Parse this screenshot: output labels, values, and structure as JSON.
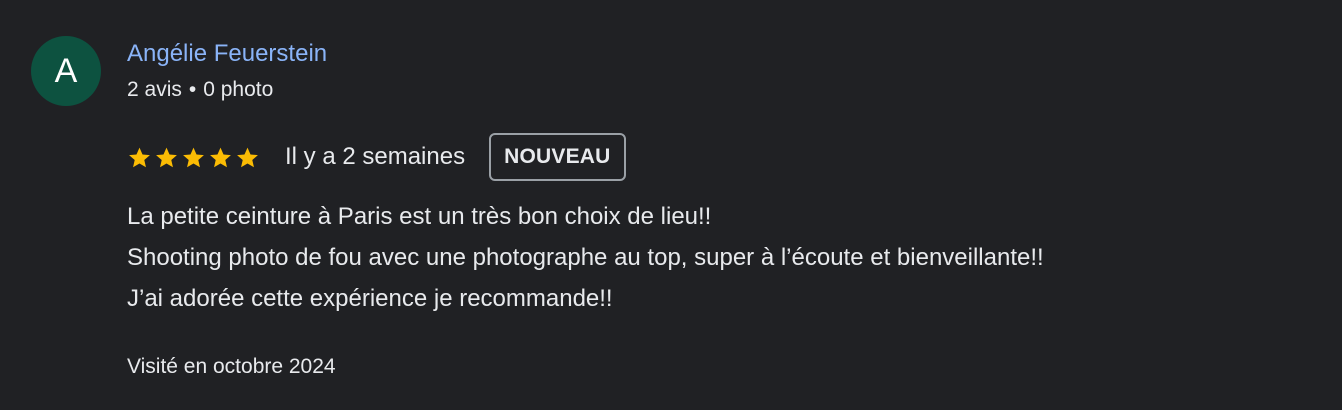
{
  "colors": {
    "background": "#202124",
    "avatar_bg": "#0d5240",
    "author_name": "#8ab4f8",
    "star": "#fbbc04",
    "text": "#e8eaed",
    "badge_border": "#9aa0a6"
  },
  "author": {
    "initial": "A",
    "name": "Angélie Feuerstein",
    "reviews_count": "2 avis",
    "separator": "•",
    "photos_count": "0 photo"
  },
  "rating": {
    "value": 5,
    "max": 5,
    "icon": "star-icon",
    "date": "Il y a 2 semaines",
    "badge": "NOUVEAU"
  },
  "review": {
    "lines": [
      "La petite ceinture à Paris est un très bon choix de lieu!!",
      "Shooting photo de fou avec une photographe au top, super à l’écoute et bienveillante!!",
      "J’ai adorée cette expérience je recommande!!"
    ]
  },
  "visit": "Visité en octobre 2024"
}
